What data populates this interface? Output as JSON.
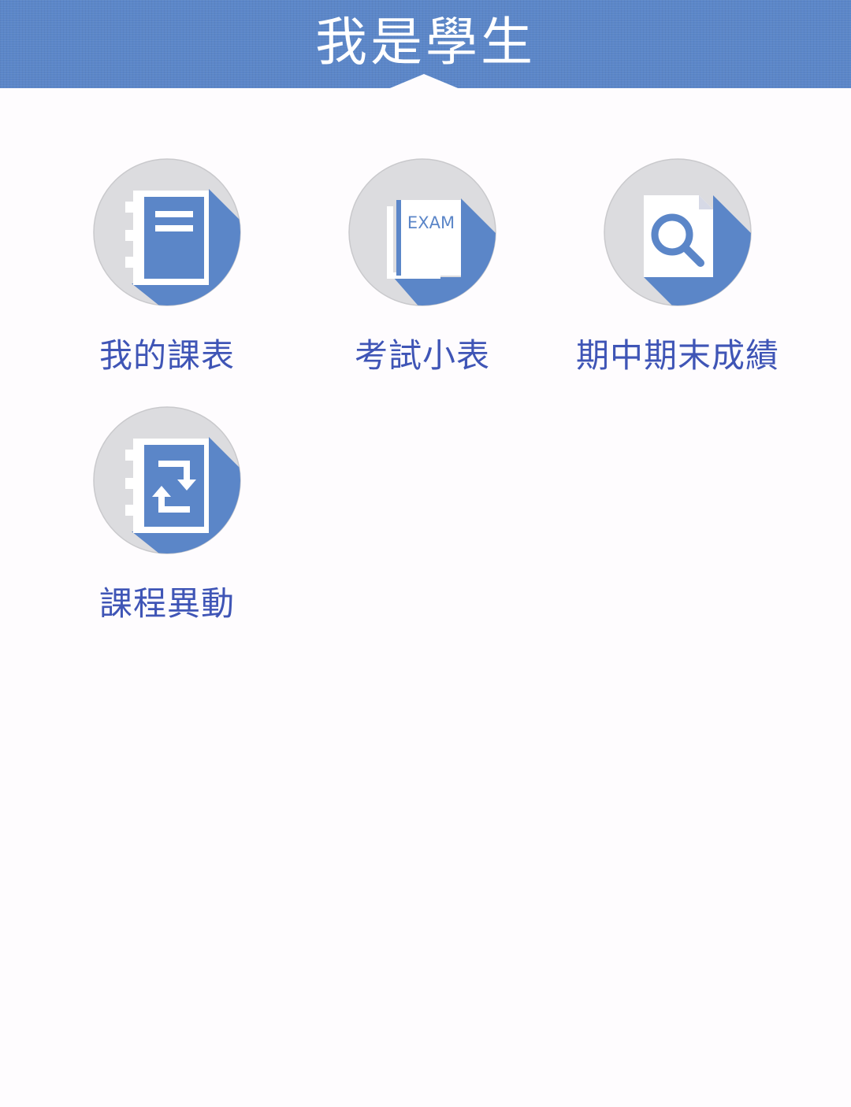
{
  "header": {
    "title": "我是學生"
  },
  "colors": {
    "header_bg": "#5b86c8",
    "icon_circle": "#dcdcdf",
    "icon_accent": "#5b86c8",
    "label_text": "#3f55b6"
  },
  "menu": {
    "items": [
      {
        "label": "我的課表",
        "icon": "notebook-icon"
      },
      {
        "label": "考試小表",
        "icon": "exam-book-icon",
        "icon_text": "EXAM"
      },
      {
        "label": "期中期末成績",
        "icon": "search-document-icon"
      },
      {
        "label": "課程異動",
        "icon": "notebook-swap-icon"
      }
    ]
  }
}
